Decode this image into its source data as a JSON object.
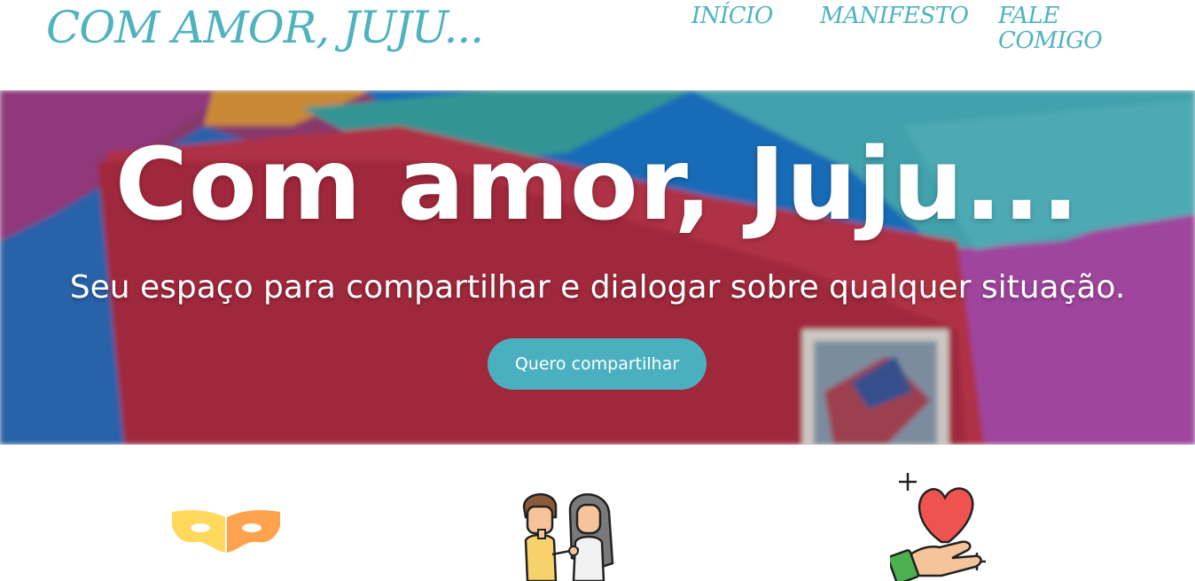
{
  "header": {
    "brand": "COM AMOR, JUJU...",
    "nav": {
      "inicio": "INÍCIO",
      "manifesto": "MANIFESTO",
      "fale": "FALE COMIGO"
    }
  },
  "hero": {
    "title": "Com amor, Juju...",
    "subtitle": "Seu espaço para compartilhar e dialogar sobre qualquer situação.",
    "cta_label": "Quero compartilhar"
  },
  "features": {
    "icons": [
      "mask-icon",
      "couple-icon",
      "hand-heart-icon"
    ]
  },
  "colors": {
    "accent": "#4fb3bf",
    "button": "#4ab0bf",
    "text_on_hero": "#ffffff"
  }
}
